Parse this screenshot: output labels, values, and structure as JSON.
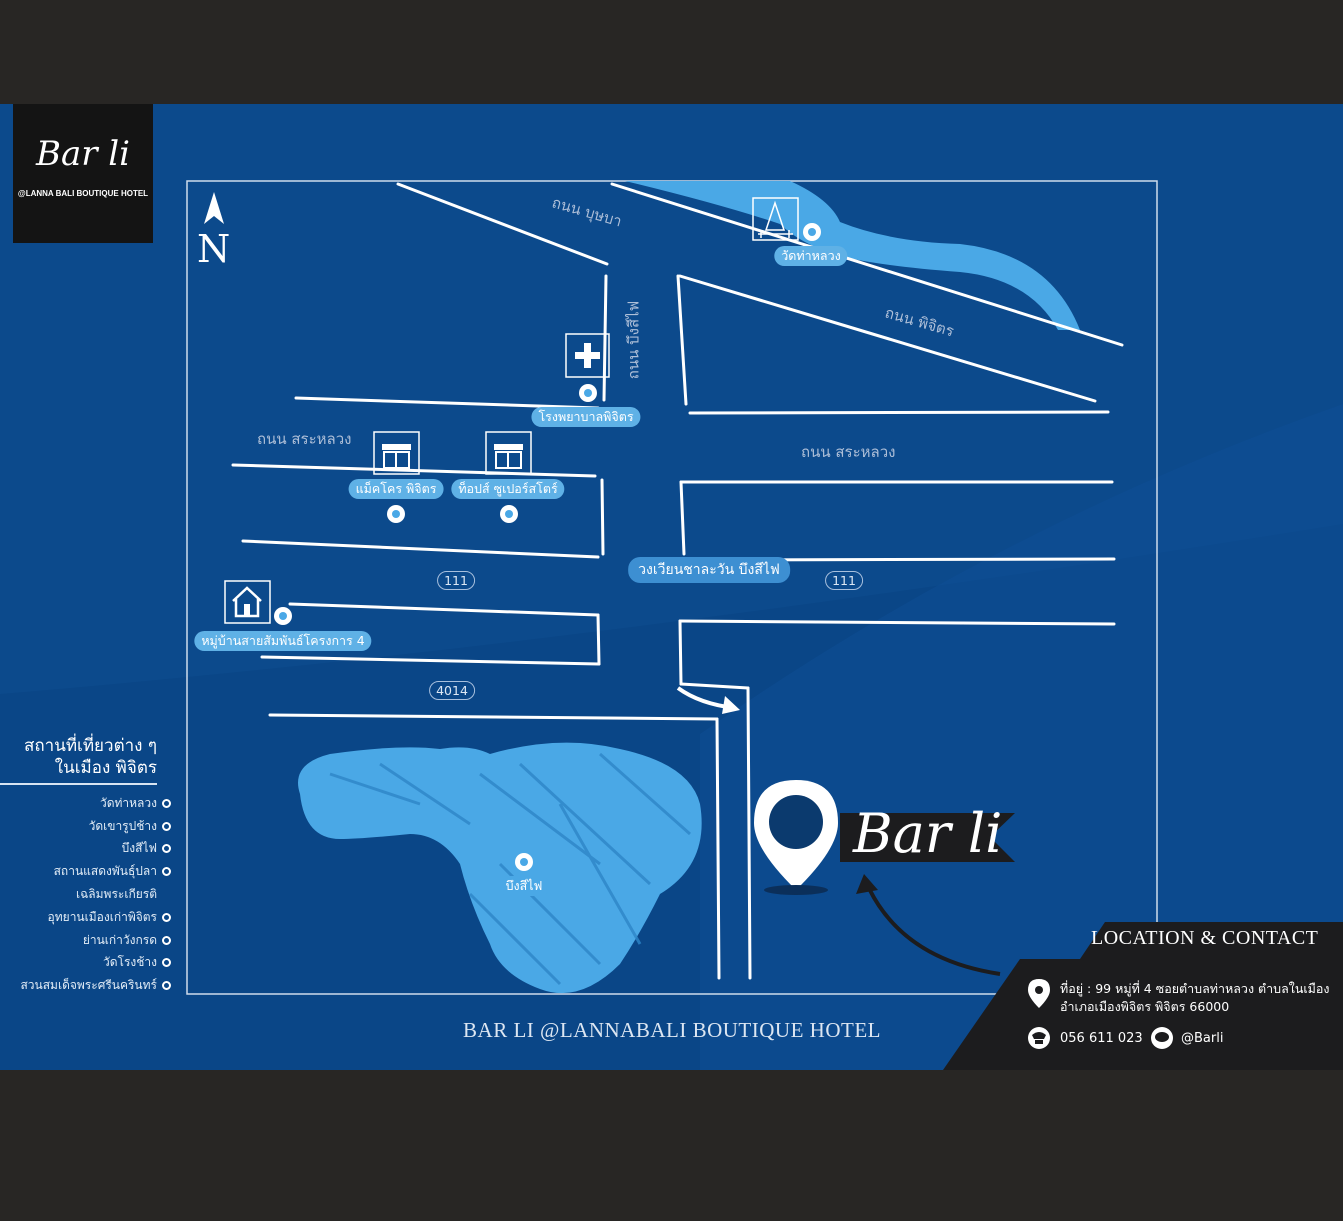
{
  "brand": {
    "logo_text": "Bar li",
    "logo_subtitle": "@LANNA BALI BOUTIQUE HOTEL",
    "marker_text": "Bar li"
  },
  "compass": {
    "label": "N"
  },
  "roads": {
    "buchaba": "ถนน บุษบา",
    "bueng_si_fai": "ถนน บึงสีไฟ",
    "phichit": "ถนน พิจิตร",
    "sa_luang_left": "ถนน สระหลวง",
    "sa_luang_right": "ถนน สระหลวง",
    "route_111_left": "111",
    "route_111_right": "111",
    "route_4014": "4014"
  },
  "places": {
    "wat_tha_luang": "วัดท่าหลวง",
    "hospital": "โรงพยาบาลพิจิตร",
    "makro": "แม็คโคร พิจิตร",
    "tops": "ท็อปส์ ซูเปอร์สโตร์",
    "roundabout": "วงเวียนชาละวัน บึงสีไฟ",
    "village": "หมู่บ้านสายสัมพันธ์โครงการ 4",
    "bueng_si_fai": "บึงสีไฟ"
  },
  "attractions": {
    "title_line1": "สถานที่เที่ยวต่าง ๆ",
    "title_line2": "ในเมือง พิจิตร",
    "items": [
      {
        "label": "วัดท่าหลวง",
        "dot": true
      },
      {
        "label": "วัดเขารูปช้าง",
        "dot": true
      },
      {
        "label": "บึงสีไฟ",
        "dot": true
      },
      {
        "label": "สถานแสดงพันธุ์ปลา",
        "dot": true
      },
      {
        "label": "เฉลิมพระเกียรติ",
        "dot": false
      },
      {
        "label": "อุทยานเมืองเก่าพิจิตร",
        "dot": true
      },
      {
        "label": "ย่านเก่าวังกรด",
        "dot": true
      },
      {
        "label": "วัดโรงช้าง",
        "dot": true
      },
      {
        "label": "สวนสมเด็จพระศรีนครินทร์",
        "dot": true
      }
    ]
  },
  "footer": {
    "title": "BAR LI @LANNABALI BOUTIQUE HOTEL"
  },
  "contact": {
    "title": "LOCATION & CONTACT",
    "address_line1": "ที่อยู่ : 99 หมู่ที่ 4 ซอยตำบลท่าหลวง ตำบลในเมือง",
    "address_line2": "อำเภอเมืองพิจิตร พิจิตร 66000",
    "phone": "056 611 023",
    "line_id": "@Barli"
  },
  "colors": {
    "background": "#0c4a8c",
    "water": "#4aa8e6",
    "road": "#ffffff",
    "label_pill": "#5fb1e6",
    "dark_panel": "#1c1c1e"
  },
  "icons": [
    "north-arrow-icon",
    "hospital-icon",
    "temple-icon",
    "store-icon",
    "house-icon",
    "location-pin-icon",
    "phone-icon",
    "line-app-icon"
  ]
}
